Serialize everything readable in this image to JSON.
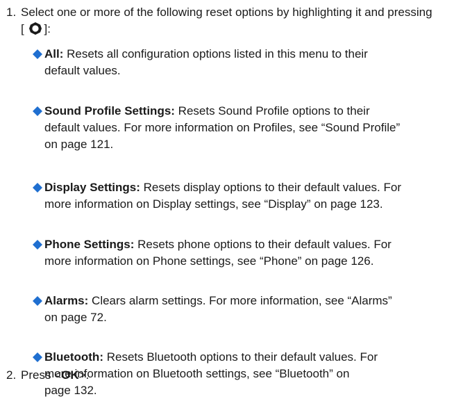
{
  "step1": {
    "number": "1.",
    "text_before": "Select one or more of the following reset options by highlighting it and pressing [",
    "nav_key_icon": "navigation-key-icon",
    "text_after": "]:"
  },
  "options": [
    {
      "label": "All:",
      "line1": " Resets all configuration options listed in this menu to their",
      "line2": "default values.",
      "line3": ""
    },
    {
      "label": "Sound Profile Settings:",
      "line1": " Resets Sound Profile options to their",
      "line2": "default values. For more information on Profiles, see “Sound Profile”",
      "line3": "on page 121."
    },
    {
      "label": "Display Settings:",
      "line1": " Resets display options to their default values. For",
      "line2": "more information on Display settings, see “Display” on page 123.",
      "line3": ""
    },
    {
      "label": "Phone Settings:",
      "line1": " Resets phone options to their default values. For",
      "line2": "more information on Phone settings, see “Phone” on page 126.",
      "line3": ""
    },
    {
      "label": "Alarms:",
      "line1": " Clears alarm settings. For more information, see “Alarms”",
      "line2": "on page 72.",
      "line3": ""
    },
    {
      "label": "Bluetooth:",
      "line1": " Resets Bluetooth options to their default values. For",
      "line2": "more information on Bluetooth settings, see “Bluetooth” on",
      "line3": "page 132."
    }
  ],
  "step2": {
    "number": "2.",
    "text_before": "Press <",
    "key": "OK",
    "text_after": ">."
  },
  "colors": {
    "bullet": "#1f6fd0",
    "text": "#1a1a1a"
  }
}
